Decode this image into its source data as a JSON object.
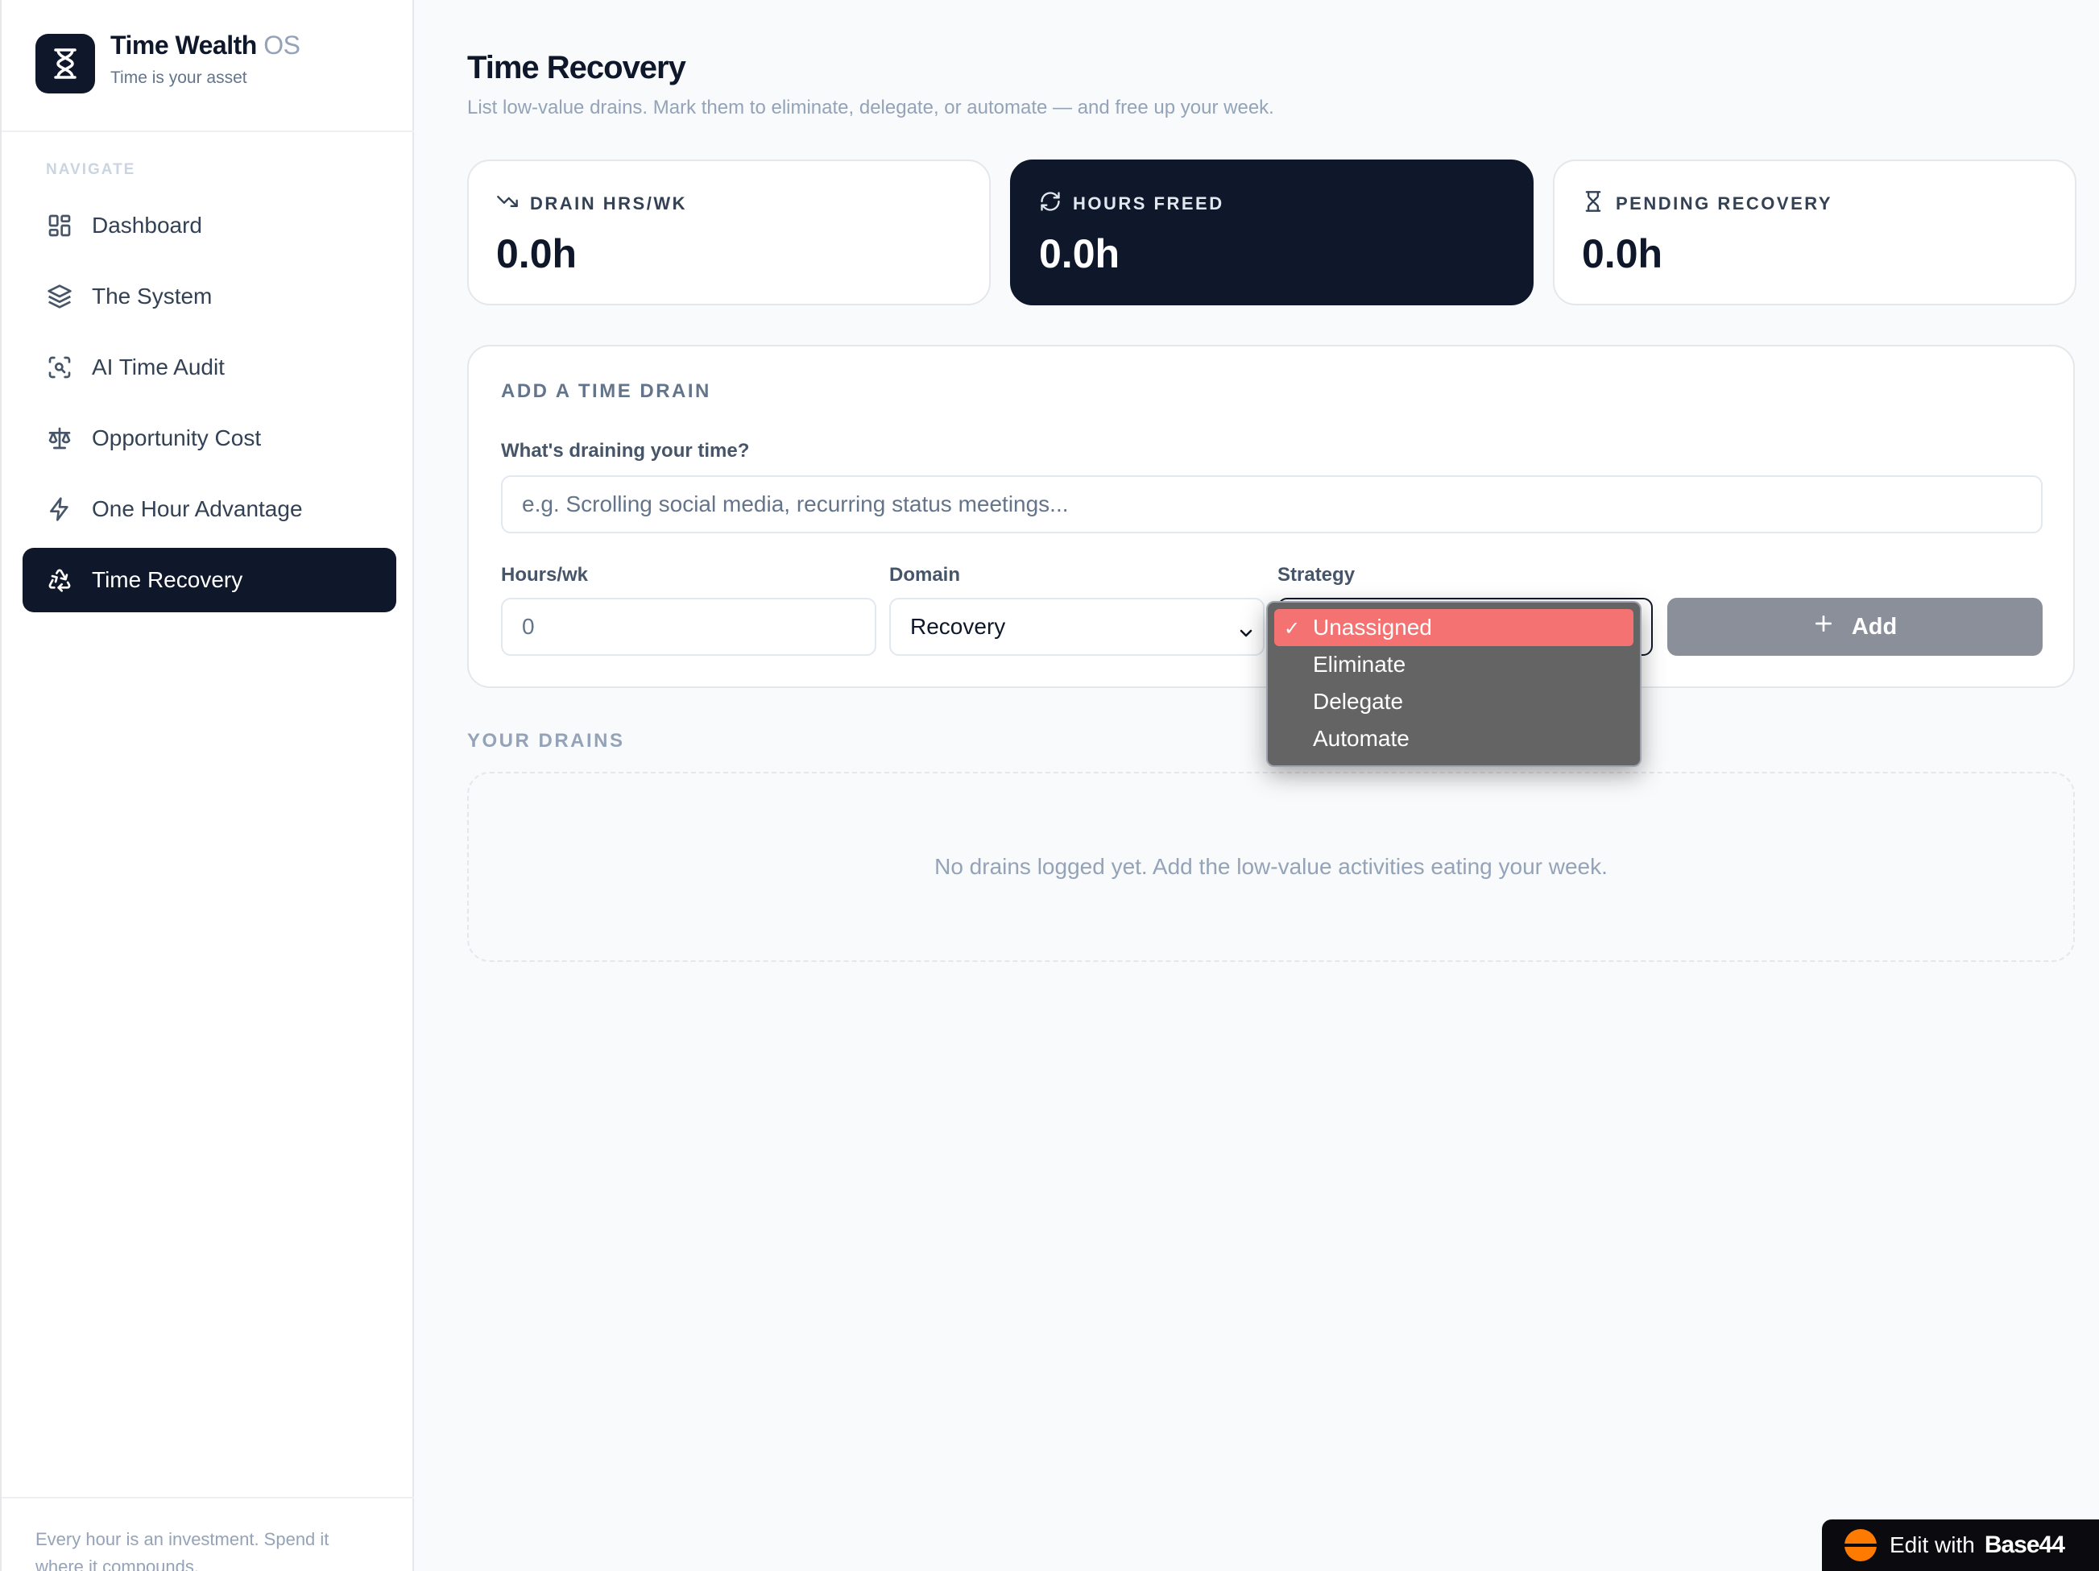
{
  "brand": {
    "name": "Time Wealth",
    "suffix": "OS",
    "tagline": "Time is your asset"
  },
  "sidebar": {
    "section_label": "NAVIGATE",
    "items": [
      {
        "label": "Dashboard",
        "icon": "dashboard-icon",
        "active": false
      },
      {
        "label": "The System",
        "icon": "layers-icon",
        "active": false
      },
      {
        "label": "AI Time Audit",
        "icon": "scan-icon",
        "active": false
      },
      {
        "label": "Opportunity Cost",
        "icon": "scale-icon",
        "active": false
      },
      {
        "label": "One Hour Advantage",
        "icon": "bolt-icon",
        "active": false
      },
      {
        "label": "Time Recovery",
        "icon": "recycle-icon",
        "active": true
      }
    ],
    "footer": "Every hour is an investment. Spend it where it compounds."
  },
  "page": {
    "title": "Time Recovery",
    "subtitle": "List low-value drains. Mark them to eliminate, delegate, or automate — and free up your week."
  },
  "stats": [
    {
      "label": "DRAIN HRS/WK",
      "value": "0.0h",
      "icon": "trending-down-icon",
      "dark": false
    },
    {
      "label": "HOURS FREED",
      "value": "0.0h",
      "icon": "refresh-icon",
      "dark": true
    },
    {
      "label": "PENDING RECOVERY",
      "value": "0.0h",
      "icon": "hourglass-icon",
      "dark": false
    }
  ],
  "form": {
    "title": "ADD A TIME DRAIN",
    "drain_label": "What's draining your time?",
    "drain_placeholder": "e.g. Scrolling social media, recurring status meetings...",
    "hours_label": "Hours/wk",
    "hours_value": "0",
    "domain_label": "Domain",
    "domain_value": "Recovery",
    "strategy_label": "Strategy",
    "strategy_value": "Unassigned",
    "add_label": "Add"
  },
  "strategy_options": [
    {
      "label": "Unassigned",
      "selected": true
    },
    {
      "label": "Eliminate",
      "selected": false
    },
    {
      "label": "Delegate",
      "selected": false
    },
    {
      "label": "Automate",
      "selected": false
    }
  ],
  "drains": {
    "section_label": "YOUR DRAINS",
    "empty_text": "No drains logged yet. Add the low-value activities eating your week."
  },
  "badge": {
    "text": "Edit with",
    "brand": "Base44"
  },
  "colors": {
    "primary": "#0f172a",
    "muted": "#94a3b8",
    "selected_option": "#f47272",
    "add_button": "#8a8f99",
    "badge_accent": "#ff7a00"
  }
}
